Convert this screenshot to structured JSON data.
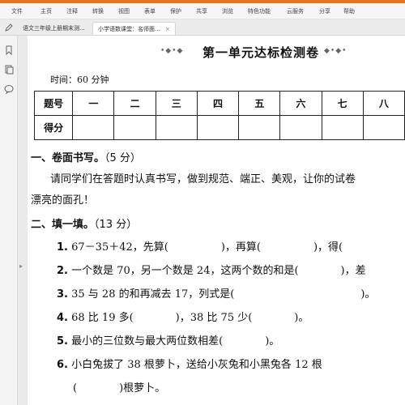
{
  "menu": [
    "文件",
    "主页",
    "注释",
    "转换",
    "视图",
    "表单",
    "保护",
    "共享",
    "浏览",
    "特色功能",
    "云服务",
    "分享",
    "帮助"
  ],
  "tabs": [
    {
      "label": "语文三年级上册期末测...",
      "close": "×"
    },
    {
      "label": "小学语数课堂：名师面...",
      "close": "×"
    }
  ],
  "doc": {
    "title": "第一单元达标检测卷",
    "deco_left": "•◆•◆",
    "deco_right": "◆•◆•",
    "time": "时间：60 分钟",
    "table": {
      "header": [
        "题号",
        "一",
        "二",
        "三",
        "四",
        "五",
        "六",
        "七",
        "八"
      ],
      "row_label": "得分"
    },
    "section1": {
      "title": "一、卷面书写。",
      "points": "（5 分）"
    },
    "section1_text": [
      "请同学们在答题时认真书写，做到规范、端正、美观，让你的试卷",
      "漂亮的面孔！"
    ],
    "section2": {
      "title": "二、填一填。",
      "points": "（13 分）"
    },
    "questions": [
      {
        "n": "1.",
        "text": "67－35＋42，先算(　　　　　)，再算(　　　　　)，得("
      },
      {
        "n": "2.",
        "text": "一个数是 70，另一个数是 24，这两个数的和是(　　　　)，差"
      },
      {
        "n": "3.",
        "text": "35 与 28 的和再减去 17，列式是(　　　　　　　　　　　　)。"
      },
      {
        "n": "4.",
        "text": "68 比 19 多(　　　　)，38 比 75 少(　　　　)。"
      },
      {
        "n": "5.",
        "text": "最小的三位数与最大两位数相差(　　　　)。"
      },
      {
        "n": "6.",
        "text": "小白兔拔了 38 根萝卜，送给小灰兔和小黑兔各 12 根"
      }
    ],
    "q6_cont": "(　　　　)根萝卜。"
  }
}
